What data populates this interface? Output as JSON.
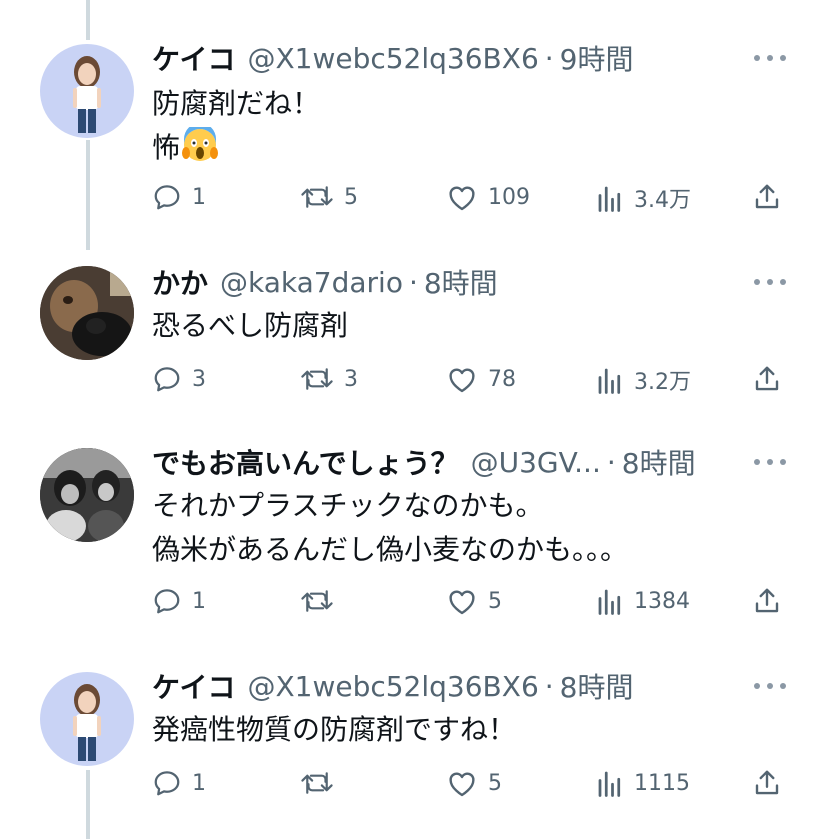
{
  "tweets": [
    {
      "name": "ケイコ",
      "handle": "@X1webc52lq36BX6",
      "time": "9時間",
      "lines": [
        "防腐剤だね！",
        "怖"
      ],
      "emoji": "scream-emoji",
      "replies": "1",
      "retweets": "5",
      "likes": "109",
      "views": "3.4万"
    },
    {
      "name": "かか",
      "handle": "@kaka7dario",
      "time": "8時間",
      "lines": [
        "恐るべし防腐剤"
      ],
      "replies": "3",
      "retweets": "3",
      "likes": "78",
      "views": "3.2万"
    },
    {
      "name": "でもお高いんでしょう？",
      "handle": "@U3GV...",
      "time": "8時間",
      "lines": [
        "それかプラスチックなのかも。",
        "偽米があるんだし偽小麦なのかも。。。"
      ],
      "replies": "1",
      "retweets": "",
      "likes": "5",
      "views": "1384"
    },
    {
      "name": "ケイコ",
      "handle": "@X1webc52lq36BX6",
      "time": "8時間",
      "lines": [
        "発癌性物質の防腐剤ですね！"
      ],
      "replies": "1",
      "retweets": "",
      "likes": "5",
      "views": "1115"
    }
  ],
  "separator": "·",
  "colors": {
    "text": "#0f1419",
    "muted": "#536471",
    "thread": "#cfd9de",
    "avatar_bg": "#c9d3f5"
  }
}
